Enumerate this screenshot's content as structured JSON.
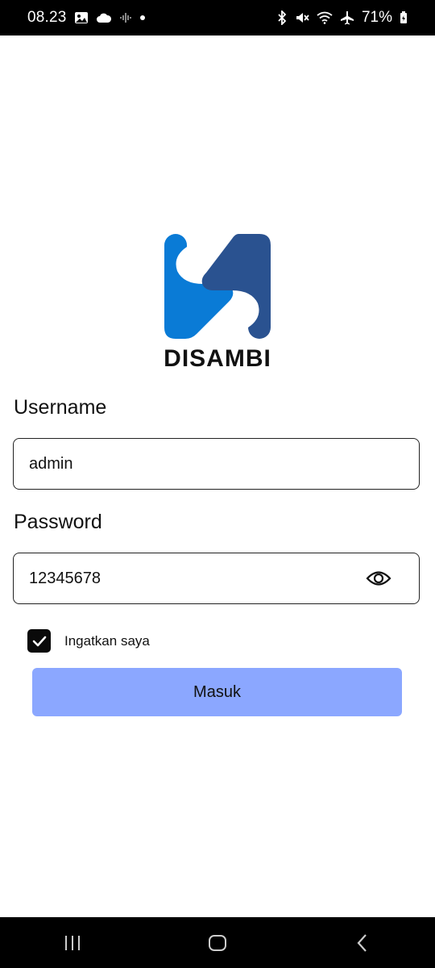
{
  "status_bar": {
    "time": "08.23",
    "battery_percent": "71%",
    "left_icons": [
      "gallery-icon",
      "cloud-icon",
      "voice-signal-icon",
      "dot-icon"
    ],
    "right_icons": [
      "bluetooth-icon",
      "mute-icon",
      "wifi-icon",
      "airplane-icon",
      "battery-icon"
    ]
  },
  "logo": {
    "text": "DISAMBI",
    "colors": {
      "light_blue": "#0a7bd6",
      "dark_blue": "#2a5290"
    }
  },
  "form": {
    "username_label": "Username",
    "username_value": "admin",
    "password_label": "Password",
    "password_value": "12345678",
    "remember_label": "Ingatkan saya",
    "remember_checked": true,
    "submit_label": "Masuk"
  },
  "colors": {
    "submit_button": "#8ba7ff",
    "checkbox": "#0a0a0a"
  },
  "nav_bar": {
    "buttons": [
      "recent-apps-icon",
      "home-icon",
      "back-icon"
    ]
  }
}
